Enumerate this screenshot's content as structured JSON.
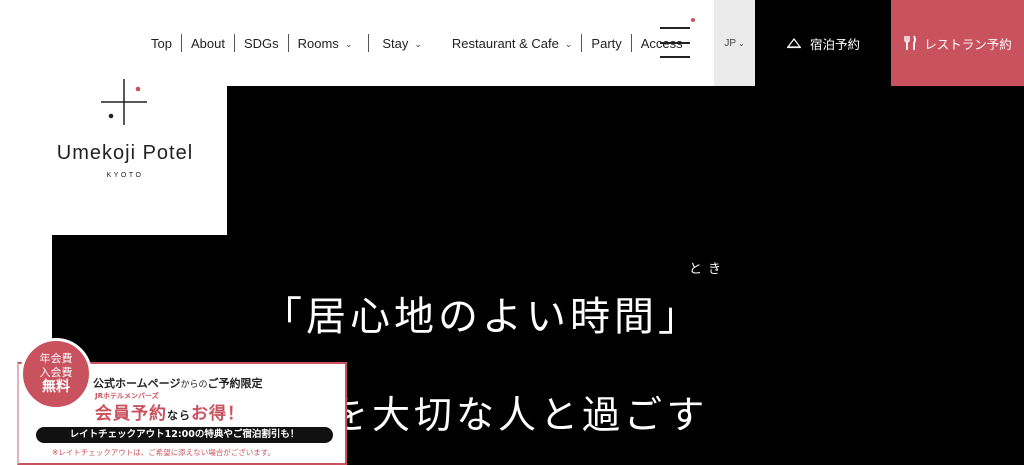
{
  "nav": {
    "items": [
      "Top",
      "About",
      "SDGs",
      "Rooms",
      "Stay",
      "Restaurant & Cafe",
      "Party",
      "Access"
    ]
  },
  "header": {
    "lang_label": "JP",
    "stay_booking_label": "宿泊予約",
    "restaurant_booking_label": "レストラン予約"
  },
  "logo": {
    "name": "Umekoji Potel",
    "city": "KYOTO"
  },
  "hero": {
    "ruby": "とき",
    "line1": "「居心地のよい時間」",
    "line2": "を大切な人と過ごす"
  },
  "promo": {
    "badge_line1": "年会費",
    "badge_line2": "入会費",
    "badge_line3": "無料",
    "headline_a": "公式ホームページ",
    "headline_b": "からの",
    "headline_c": "ご予約限定",
    "sub": "JRホテルメンバーズ",
    "main_a": "会員予約",
    "main_b": "なら",
    "main_c": "お得！",
    "strip": "レイトチェックアウト12:00の特典やご宿泊割引も！",
    "note": "※レイトチェックアウトは、ご希望に添えない場合がございます。"
  },
  "colors": {
    "accent": "#c9525f",
    "hero_bg": "#000000",
    "lang_bg": "#ebebeb"
  }
}
